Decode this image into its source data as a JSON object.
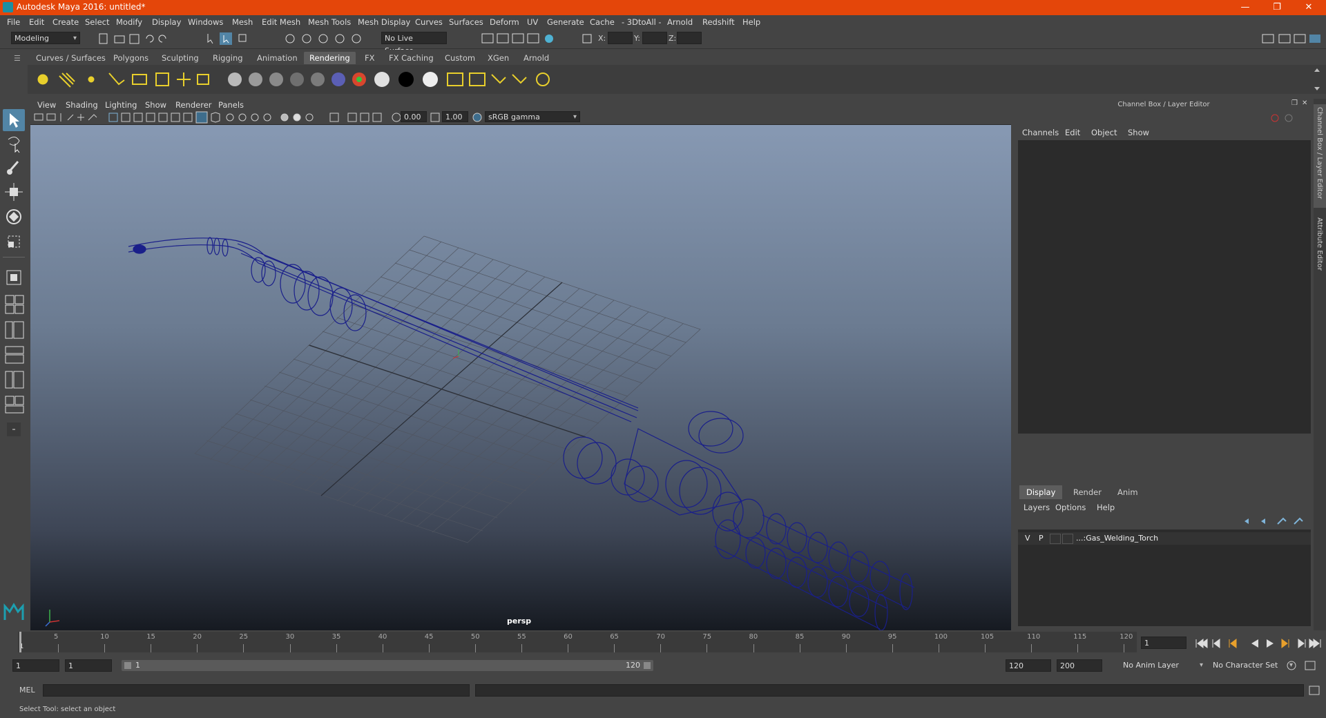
{
  "app": {
    "title": "Autodesk Maya 2016: untitled*",
    "accent_color": "#e4460a"
  },
  "window_controls": [
    "minimize-icon",
    "restore-icon",
    "close-icon"
  ],
  "menubar": [
    "File",
    "Edit",
    "Create",
    "Select",
    "Modify",
    "Display",
    "Windows",
    "Mesh",
    "Edit Mesh",
    "Mesh Tools",
    "Mesh Display",
    "Curves",
    "Surfaces",
    "Deform",
    "UV",
    "Generate",
    "Cache",
    "- 3DtoAll -",
    "Arnold",
    "Redshift",
    "Help"
  ],
  "statusline": {
    "mode": "Modeling",
    "live_surface": "No Live Surface",
    "x_label": "X:",
    "y_label": "Y:",
    "z_label": "Z:"
  },
  "shelf": {
    "tabs": [
      "Curves / Surfaces",
      "Polygons",
      "Sculpting",
      "Rigging",
      "Animation",
      "Rendering",
      "FX",
      "FX Caching",
      "Custom",
      "XGen",
      "Arnold"
    ],
    "active_tab": "Rendering"
  },
  "viewport": {
    "menu": [
      "View",
      "Shading",
      "Lighting",
      "Show",
      "Renderer",
      "Panels"
    ],
    "exposure": "0.00",
    "gamma": "1.00",
    "color_space": "sRGB gamma",
    "camera_label": "persp"
  },
  "channel_box": {
    "header": "Channel Box / Layer Editor",
    "menu": [
      "Channels",
      "Edit",
      "Object",
      "Show"
    ],
    "side_tabs": [
      "Channel Box / Layer Editor",
      "Attribute Editor"
    ]
  },
  "layer_editor": {
    "tabs": [
      "Display",
      "Render",
      "Anim"
    ],
    "active_tab": "Display",
    "menu": [
      "Layers",
      "Options",
      "Help"
    ],
    "layers": [
      {
        "v": "V",
        "p": "P",
        "name": "...:Gas_Welding_Torch"
      }
    ]
  },
  "timeline": {
    "ticks": [
      "5",
      "10",
      "15",
      "20",
      "25",
      "30",
      "35",
      "40",
      "45",
      "50",
      "55",
      "60",
      "65",
      "70",
      "75",
      "80",
      "85",
      "90",
      "95",
      "100",
      "105",
      "110",
      "115",
      "120"
    ],
    "start_label": "1",
    "current_frame": "1"
  },
  "range": {
    "start": "1",
    "playback_start": "1",
    "slider_start": "1",
    "slider_end": "120",
    "playback_end": "120",
    "end": "200",
    "anim_layer": "No Anim Layer",
    "character_set": "No Character Set"
  },
  "command": {
    "label": "MEL"
  },
  "help_line": "Select Tool: select an object"
}
